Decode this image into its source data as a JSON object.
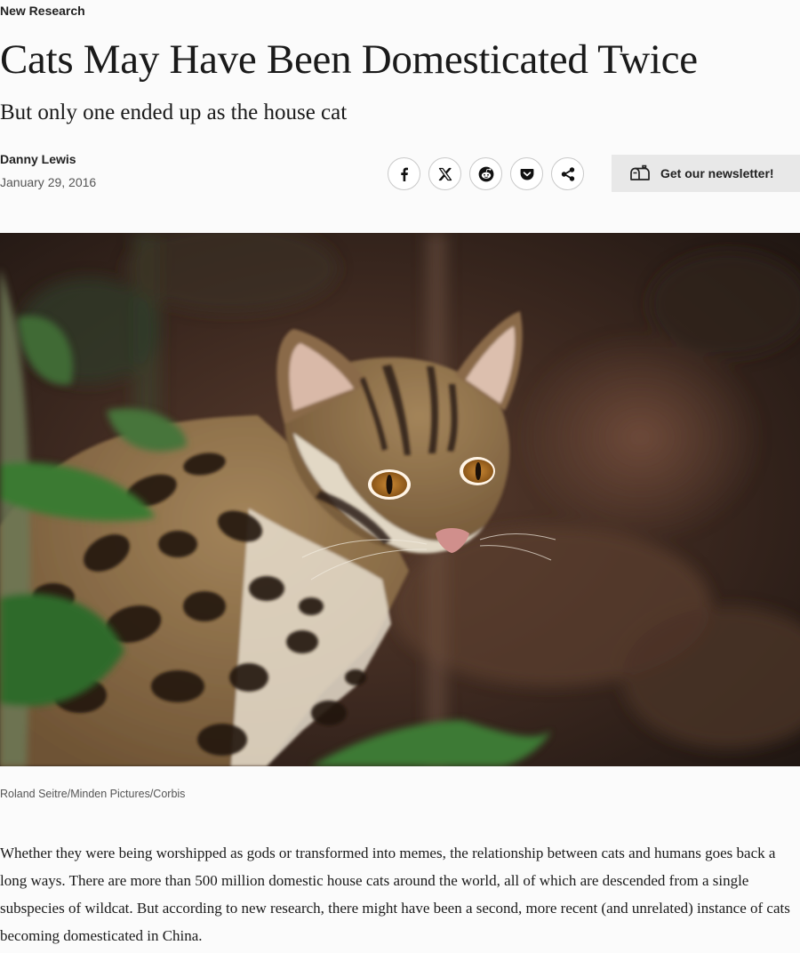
{
  "article": {
    "kicker": "New Research",
    "headline": "Cats May Have Been Domesticated Twice",
    "dek": "But only one ended up as the house cat",
    "author": "Danny Lewis",
    "date": "January 29, 2016"
  },
  "share": {
    "buttons": [
      {
        "icon": "facebook-icon"
      },
      {
        "icon": "x-icon"
      },
      {
        "icon": "reddit-icon"
      },
      {
        "icon": "pocket-icon"
      },
      {
        "icon": "share-icon"
      }
    ]
  },
  "newsletter": {
    "label": "Get our newsletter!",
    "icon": "mailbox-icon"
  },
  "photo": {
    "credit": "Roland Seitre/Minden Pictures/Corbis"
  },
  "body": {
    "paragraph_1": "Whether they were being worshipped as gods or transformed into memes, the relationship between cats and humans goes back a long ways. There are more than 500 million domestic house cats around the world, all of which are descended from a single subspecies of wildcat. But according to new research, there might have been a second, more recent (and unrelated) instance of cats becoming domesticated in China."
  }
}
